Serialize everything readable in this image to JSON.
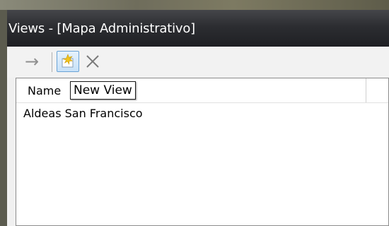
{
  "window": {
    "title": "Views - [Mapa Administrativo]"
  },
  "toolbar": {
    "items": [
      {
        "icon": "arrow-right-icon",
        "glyph": "→"
      },
      {
        "icon": "new-view-icon"
      },
      {
        "icon": "delete-icon"
      }
    ]
  },
  "list": {
    "columns": [
      "Name"
    ],
    "rows": [
      "Aldeas San Francisco"
    ]
  },
  "tooltip": {
    "text": "New View"
  }
}
